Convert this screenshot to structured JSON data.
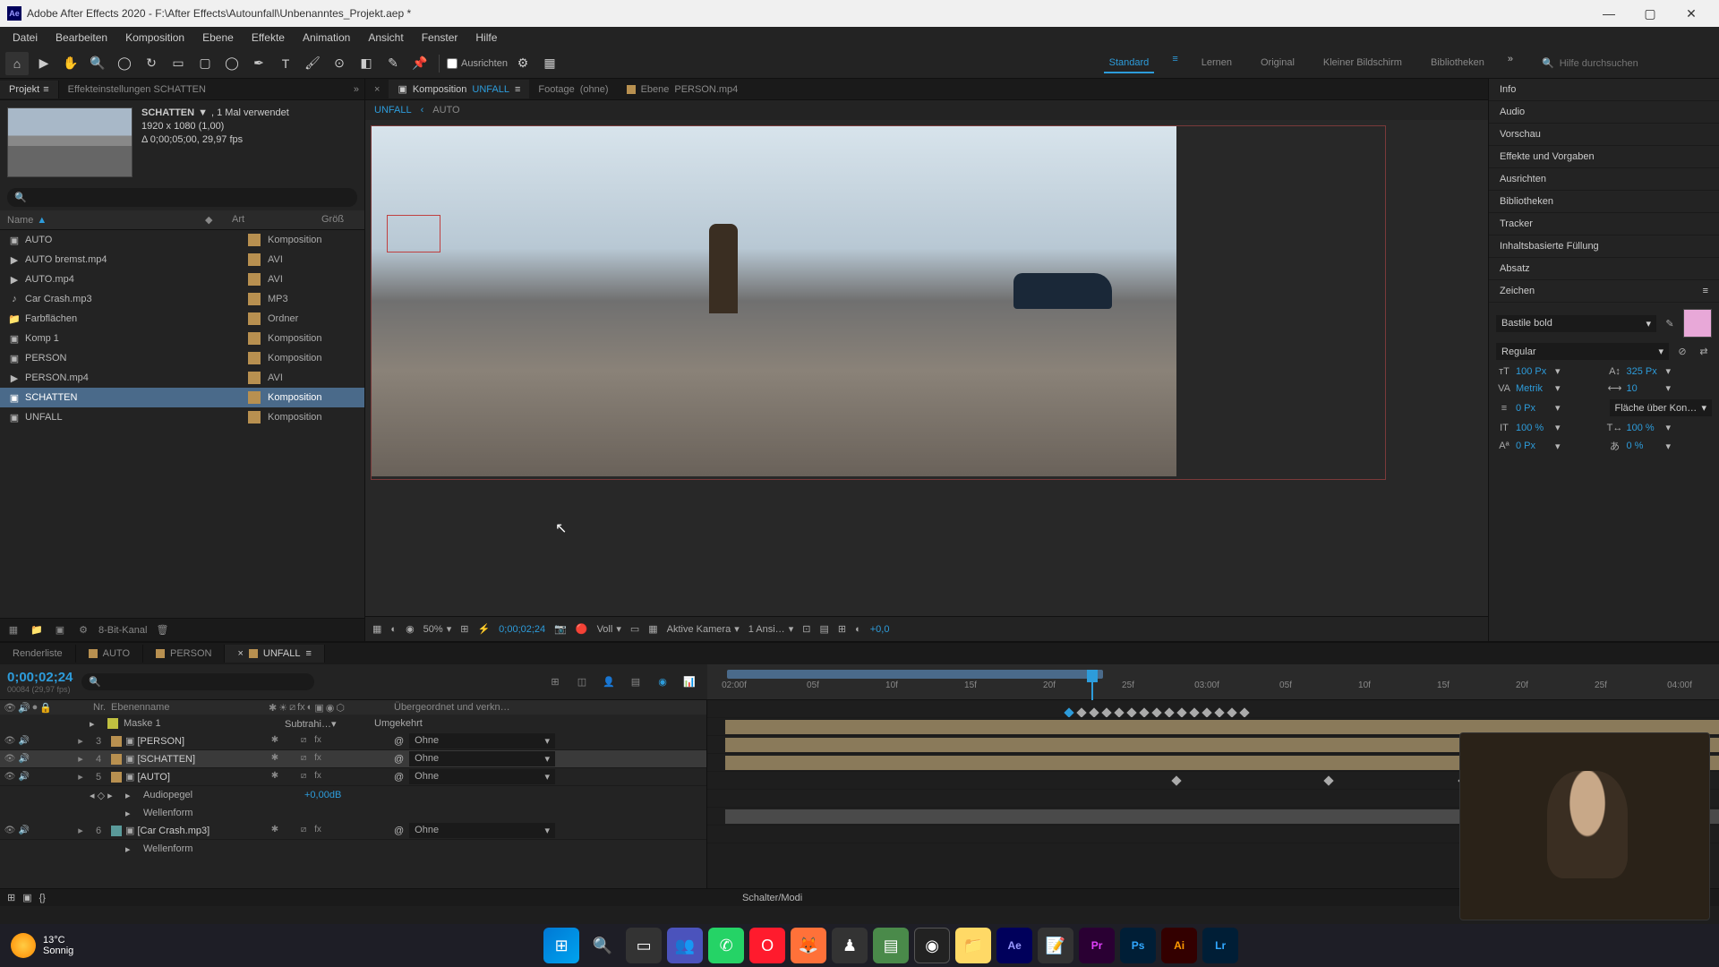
{
  "titlebar": {
    "app_icon": "Ae",
    "title": "Adobe After Effects 2020 - F:\\After Effects\\Autounfall\\Unbenanntes_Projekt.aep *"
  },
  "menu": [
    "Datei",
    "Bearbeiten",
    "Komposition",
    "Ebene",
    "Effekte",
    "Animation",
    "Ansicht",
    "Fenster",
    "Hilfe"
  ],
  "toolbar": {
    "align_label": "Ausrichten",
    "workspaces": [
      "Standard",
      "Lernen",
      "Original",
      "Kleiner Bildschirm",
      "Bibliotheken"
    ],
    "active_workspace": "Standard",
    "help_placeholder": "Hilfe durchsuchen"
  },
  "project": {
    "tab": "Projekt",
    "settings_tab": "Effekteinstellungen SCHATTEN",
    "selected_name": "SCHATTEN",
    "usage": ", 1 Mal verwendet",
    "res": "1920 x 1080 (1,00)",
    "dur": "Δ 0;00;05;00, 29,97 fps",
    "col_name": "Name",
    "col_art": "Art",
    "col_size": "Größ",
    "items": [
      {
        "name": "AUTO",
        "art": "Komposition",
        "icon": "comp"
      },
      {
        "name": "AUTO bremst.mp4",
        "art": "AVI",
        "icon": "video"
      },
      {
        "name": "AUTO.mp4",
        "art": "AVI",
        "icon": "video"
      },
      {
        "name": "Car Crash.mp3",
        "art": "MP3",
        "icon": "audio"
      },
      {
        "name": "Farbflächen",
        "art": "Ordner",
        "icon": "folder"
      },
      {
        "name": "Komp 1",
        "art": "Komposition",
        "icon": "comp"
      },
      {
        "name": "PERSON",
        "art": "Komposition",
        "icon": "comp"
      },
      {
        "name": "PERSON.mp4",
        "art": "AVI",
        "icon": "video"
      },
      {
        "name": "SCHATTEN",
        "art": "Komposition",
        "icon": "comp",
        "selected": true
      },
      {
        "name": "UNFALL",
        "art": "Komposition",
        "icon": "comp"
      }
    ],
    "footer_bpc": "8-Bit-Kanal"
  },
  "viewer": {
    "tabs": [
      {
        "prefix": "Komposition",
        "name": "UNFALL",
        "active": true
      },
      {
        "prefix": "Footage",
        "name": "(ohne)"
      },
      {
        "prefix": "Ebene",
        "name": "PERSON.mp4"
      }
    ],
    "breadcrumb": [
      "UNFALL",
      "AUTO"
    ],
    "footer": {
      "zoom": "50%",
      "timecode": "0;00;02;24",
      "res": "Voll",
      "camera": "Aktive Kamera",
      "views": "1 Ansi…",
      "exposure": "+0,0"
    }
  },
  "right_panels": [
    "Info",
    "Audio",
    "Vorschau",
    "Effekte und Vorgaben",
    "Ausrichten",
    "Bibliotheken",
    "Tracker",
    "Inhaltsbasierte Füllung",
    "Absatz"
  ],
  "char": {
    "title": "Zeichen",
    "font": "Bastile bold",
    "style": "Regular",
    "size": "100 Px",
    "leading": "325 Px",
    "kerning": "Metrik",
    "tracking": "10",
    "stroke": "0 Px",
    "stroke_opt": "Fläche über Kon…",
    "vscale": "100 %",
    "hscale": "100 %",
    "baseline": "0 Px",
    "tsume": "0 %",
    "swatch": "#e8a8d8"
  },
  "timeline": {
    "tabs": [
      "Renderliste",
      "AUTO",
      "PERSON",
      "UNFALL"
    ],
    "active_tab": "UNFALL",
    "timecode": "0;00;02;24",
    "timecode_sub": "00084 (29,97 fps)",
    "ruler": [
      "02:00f",
      "05f",
      "10f",
      "15f",
      "20f",
      "25f",
      "03:00f",
      "05f",
      "10f",
      "15f",
      "20f",
      "25f",
      "04:00f"
    ],
    "col_header": {
      "nr": "Nr.",
      "name": "Ebenenname",
      "parent": "Übergeordnet und verkn…"
    },
    "layers": [
      {
        "type": "mask",
        "name": "Maske 1",
        "mode": "Subtrahi…",
        "invert": "Umgekehrt"
      },
      {
        "num": "3",
        "name": "[PERSON]",
        "parent": "Ohne",
        "color": "tan"
      },
      {
        "num": "4",
        "name": "[SCHATTEN]",
        "parent": "Ohne",
        "color": "tan",
        "selected": true
      },
      {
        "num": "5",
        "name": "[AUTO]",
        "parent": "Ohne",
        "color": "tan"
      },
      {
        "type": "prop",
        "name": "Audiopegel",
        "value": "+0,00dB"
      },
      {
        "type": "prop",
        "name": "Wellenform"
      },
      {
        "num": "6",
        "name": "[Car Crash.mp3]",
        "parent": "Ohne",
        "color": "cyan"
      },
      {
        "type": "prop",
        "name": "Wellenform"
      }
    ],
    "footer_switch": "Schalter/Modi"
  },
  "taskbar": {
    "temp": "13°C",
    "weather": "Sonnig"
  }
}
